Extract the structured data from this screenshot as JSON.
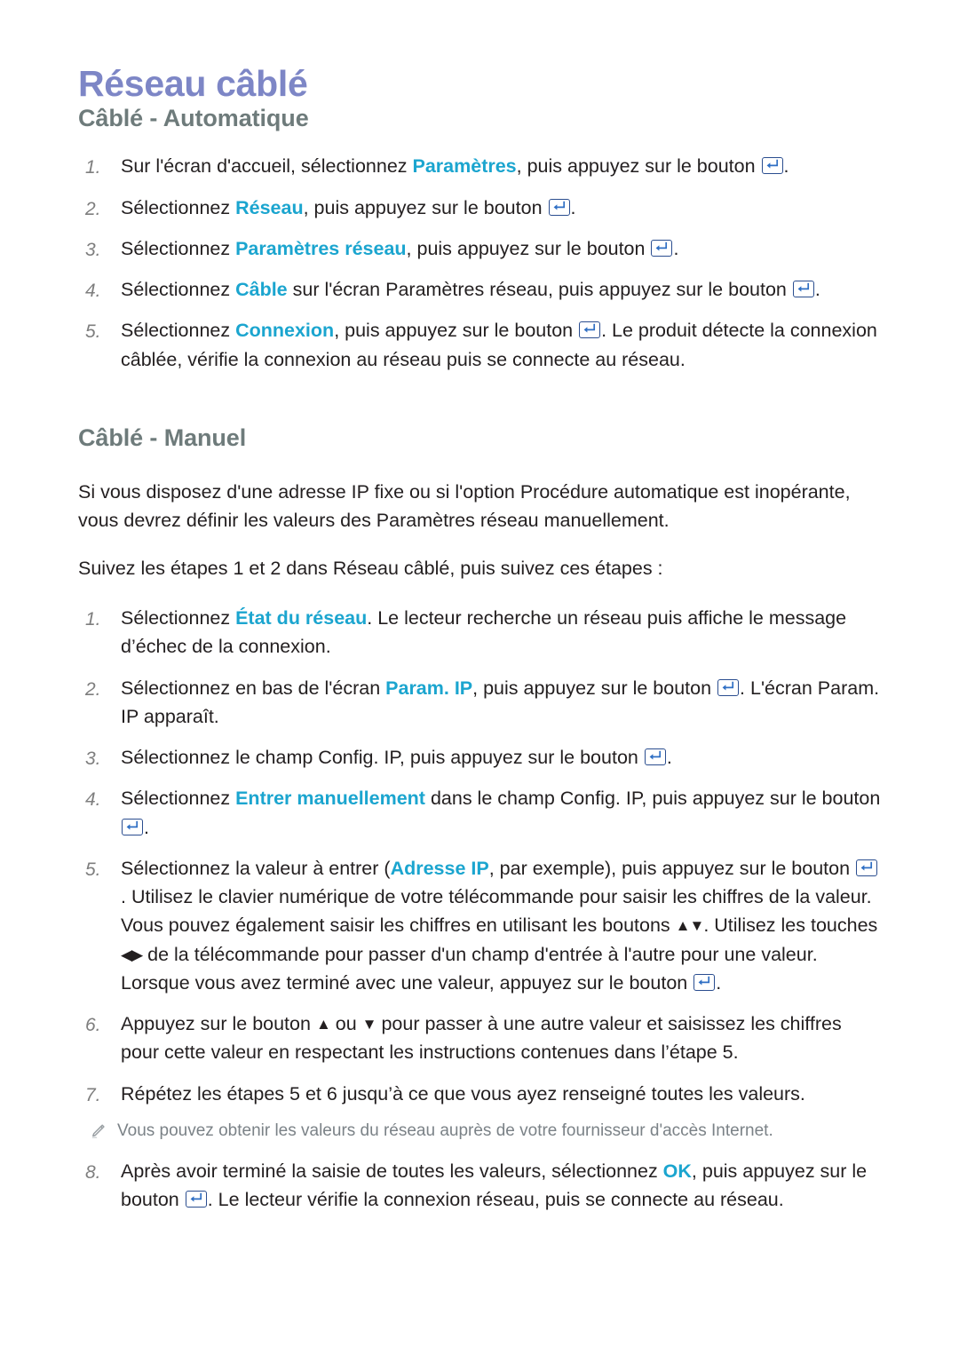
{
  "document": {
    "title": "Réseau câblé",
    "title_color": "#7d86c6",
    "heading_color": "#6e7b7b",
    "keyword_color": "#1ba5cf",
    "note_color": "#7b8287",
    "number_color": "#7e7e7e",
    "body_color": "#231f20",
    "background": "#ffffff"
  },
  "sections": [
    {
      "heading": "Câblé - Automatique",
      "steps": [
        {
          "number": "1.",
          "parts": [
            {
              "t": "Sur l'écran d'accueil, sélectionnez ",
              "style": "plain"
            },
            {
              "t": "Paramètres",
              "style": "keyword"
            },
            {
              "t": ", puis appuyez sur le bouton ",
              "style": "plain"
            },
            {
              "t": "enter-key-icon",
              "style": "icon"
            },
            {
              "t": ".",
              "style": "plain"
            }
          ]
        },
        {
          "number": "2.",
          "parts": [
            {
              "t": "Sélectionnez ",
              "style": "plain"
            },
            {
              "t": "Réseau",
              "style": "keyword"
            },
            {
              "t": ", puis appuyez sur le bouton ",
              "style": "plain"
            },
            {
              "t": "enter-key-icon",
              "style": "icon"
            },
            {
              "t": ".",
              "style": "plain"
            }
          ]
        },
        {
          "number": "3.",
          "parts": [
            {
              "t": "Sélectionnez ",
              "style": "plain"
            },
            {
              "t": "Paramètres réseau",
              "style": "keyword"
            },
            {
              "t": ", puis appuyez sur le bouton ",
              "style": "plain"
            },
            {
              "t": "enter-key-icon",
              "style": "icon"
            },
            {
              "t": ".",
              "style": "plain"
            }
          ]
        },
        {
          "number": "4.",
          "parts": [
            {
              "t": "Sélectionnez ",
              "style": "plain"
            },
            {
              "t": "Câble",
              "style": "keyword"
            },
            {
              "t": " sur l'écran Paramètres réseau, puis appuyez sur le bouton ",
              "style": "plain"
            },
            {
              "t": "enter-key-icon",
              "style": "icon"
            },
            {
              "t": ".",
              "style": "plain"
            }
          ]
        },
        {
          "number": "5.",
          "parts": [
            {
              "t": "Sélectionnez ",
              "style": "plain"
            },
            {
              "t": "Connexion",
              "style": "keyword"
            },
            {
              "t": ", puis appuyez sur le bouton ",
              "style": "plain"
            },
            {
              "t": "enter-key-icon",
              "style": "icon"
            },
            {
              "t": ". Le produit détecte la connexion câblée, vérifie la connexion au réseau puis se connecte au réseau.",
              "style": "plain"
            }
          ]
        }
      ]
    },
    {
      "heading": "Câblé - Manuel",
      "paragraphs": [
        "Si vous disposez d'une adresse IP fixe ou si l'option Procédure automatique est inopérante, vous devrez définir les valeurs des Paramètres réseau manuellement.",
        "Suivez les étapes 1 et 2 dans Réseau câblé, puis suivez ces étapes :"
      ],
      "steps": [
        {
          "number": "1.",
          "parts": [
            {
              "t": "Sélectionnez ",
              "style": "plain"
            },
            {
              "t": "État du réseau",
              "style": "keyword"
            },
            {
              "t": ". Le lecteur recherche un réseau puis affiche le message d’échec de la connexion.",
              "style": "plain"
            }
          ]
        },
        {
          "number": "2.",
          "parts": [
            {
              "t": "Sélectionnez en bas de l'écran ",
              "style": "plain"
            },
            {
              "t": "Param. IP",
              "style": "keyword"
            },
            {
              "t": ", puis appuyez sur le bouton ",
              "style": "plain"
            },
            {
              "t": "enter-key-icon",
              "style": "icon"
            },
            {
              "t": ". L'écran Param. IP apparaît.",
              "style": "plain"
            }
          ]
        },
        {
          "number": "3.",
          "parts": [
            {
              "t": "Sélectionnez le champ Config. IP, puis appuyez sur le bouton ",
              "style": "plain"
            },
            {
              "t": "enter-key-icon",
              "style": "icon"
            },
            {
              "t": ".",
              "style": "plain"
            }
          ]
        },
        {
          "number": "4.",
          "parts": [
            {
              "t": "Sélectionnez ",
              "style": "plain"
            },
            {
              "t": "Entrer manuellement",
              "style": "keyword"
            },
            {
              "t": " dans le champ Config. IP, puis appuyez sur le bouton ",
              "style": "plain"
            },
            {
              "t": "enter-key-icon",
              "style": "icon"
            },
            {
              "t": ".",
              "style": "plain"
            }
          ]
        },
        {
          "number": "5.",
          "parts": [
            {
              "t": "Sélectionnez la valeur à entrer (",
              "style": "plain"
            },
            {
              "t": "Adresse IP",
              "style": "keyword"
            },
            {
              "t": ", par exemple), puis appuyez sur le bouton ",
              "style": "plain"
            },
            {
              "t": "enter-key-icon",
              "style": "icon"
            },
            {
              "t": ". Utilisez le clavier numérique de votre télécommande pour saisir les chiffres de la valeur. Vous pouvez également saisir les chiffres en utilisant les boutons ",
              "style": "plain"
            },
            {
              "t": "▲▼",
              "style": "arrow"
            },
            {
              "t": ". Utilisez les touches ",
              "style": "plain"
            },
            {
              "t": "◀▶",
              "style": "arrow"
            },
            {
              "t": " de la télécommande pour passer d'un champ d'entrée à l'autre pour une valeur. Lorsque vous avez terminé avec une valeur, appuyez sur le bouton ",
              "style": "plain"
            },
            {
              "t": "enter-key-icon",
              "style": "icon"
            },
            {
              "t": ".",
              "style": "plain"
            }
          ]
        },
        {
          "number": "6.",
          "parts": [
            {
              "t": "Appuyez sur le bouton ",
              "style": "plain"
            },
            {
              "t": "▲",
              "style": "arrow"
            },
            {
              "t": " ou ",
              "style": "plain"
            },
            {
              "t": "▼",
              "style": "arrow"
            },
            {
              "t": " pour passer à une autre valeur et saisissez les chiffres pour cette valeur en respectant les instructions contenues dans l’étape 5.",
              "style": "plain"
            }
          ]
        },
        {
          "number": "7.",
          "parts": [
            {
              "t": "Répétez les étapes 5 et 6 jusqu’à ce que vous ayez renseigné toutes les valeurs.",
              "style": "plain"
            }
          ]
        }
      ],
      "note": {
        "icon": "pencil-icon",
        "text": "Vous pouvez obtenir les valeurs du réseau auprès de votre fournisseur d'accès Internet."
      },
      "steps_after_note": [
        {
          "number": "8.",
          "parts": [
            {
              "t": "Après avoir terminé la saisie de toutes les valeurs, sélectionnez ",
              "style": "plain"
            },
            {
              "t": "OK",
              "style": "keyword"
            },
            {
              "t": ", puis appuyez sur le bouton ",
              "style": "plain"
            },
            {
              "t": "enter-key-icon",
              "style": "icon"
            },
            {
              "t": ". Le lecteur vérifie la connexion réseau, puis se connecte au réseau.",
              "style": "plain"
            }
          ]
        }
      ]
    }
  ]
}
